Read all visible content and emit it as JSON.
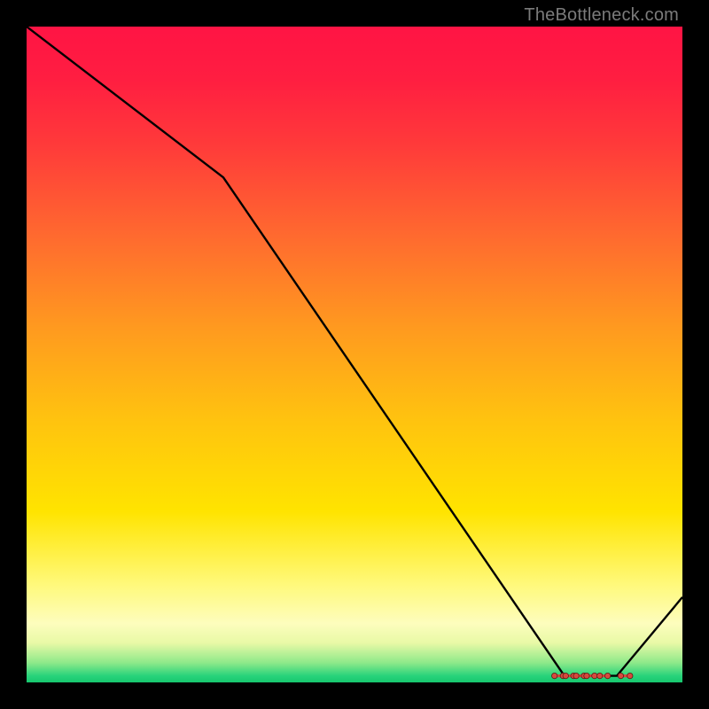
{
  "watermark": "TheBottleneck.com",
  "chart_data": {
    "type": "line",
    "title": "",
    "xlabel": "",
    "ylabel": "",
    "xlim": [
      0,
      100
    ],
    "ylim": [
      0,
      100
    ],
    "series": [
      {
        "name": "curve",
        "x": [
          0,
          30,
          82,
          90,
          100
        ],
        "values": [
          100,
          77,
          1,
          1,
          13
        ]
      }
    ],
    "markers": {
      "name": "bottom-cluster",
      "x_pairs": [
        [
          80.5,
          81.8
        ],
        [
          82.2,
          83.4
        ],
        [
          83.8,
          85.0
        ],
        [
          85.4,
          86.6
        ],
        [
          87.4,
          88.6
        ],
        [
          90.6,
          92.0
        ]
      ],
      "y": 1
    }
  },
  "colors": {
    "line": "#000000",
    "marker_fill": "#d64a3e",
    "marker_stroke": "#5a1a14"
  }
}
